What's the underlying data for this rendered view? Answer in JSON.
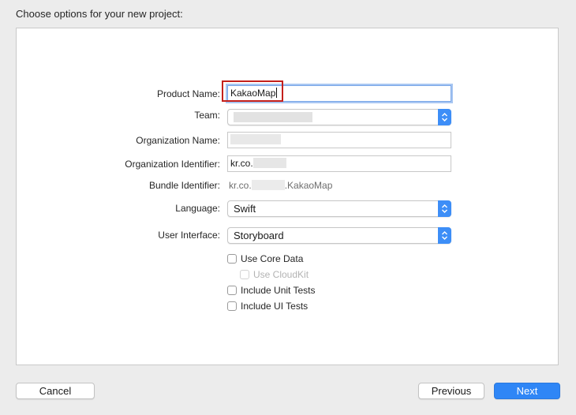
{
  "header": {
    "title": "Choose options for your new project:"
  },
  "form": {
    "product_name": {
      "label": "Product Name:",
      "value": "KakaoMap"
    },
    "team": {
      "label": "Team:"
    },
    "organization_name": {
      "label": "Organization Name:"
    },
    "organization_identifier": {
      "label": "Organization Identifier:",
      "value_prefix": "kr.co."
    },
    "bundle_identifier": {
      "label": "Bundle Identifier:",
      "prefix": "kr.co.",
      "suffix": ".KakaoMap"
    },
    "language": {
      "label": "Language:",
      "value": "Swift"
    },
    "user_interface": {
      "label": "User Interface:",
      "value": "Storyboard"
    },
    "options": {
      "use_core_data": {
        "label": "Use Core Data",
        "checked": false
      },
      "use_cloudkit": {
        "label": "Use CloudKit",
        "checked": false,
        "enabled": false
      },
      "include_unit_tests": {
        "label": "Include Unit Tests",
        "checked": false
      },
      "include_ui_tests": {
        "label": "Include UI Tests",
        "checked": false
      }
    }
  },
  "footer": {
    "cancel_label": "Cancel",
    "previous_label": "Previous",
    "next_label": "Next"
  },
  "colors": {
    "accent": "#2f86f6",
    "highlight_box": "#c4201c"
  }
}
